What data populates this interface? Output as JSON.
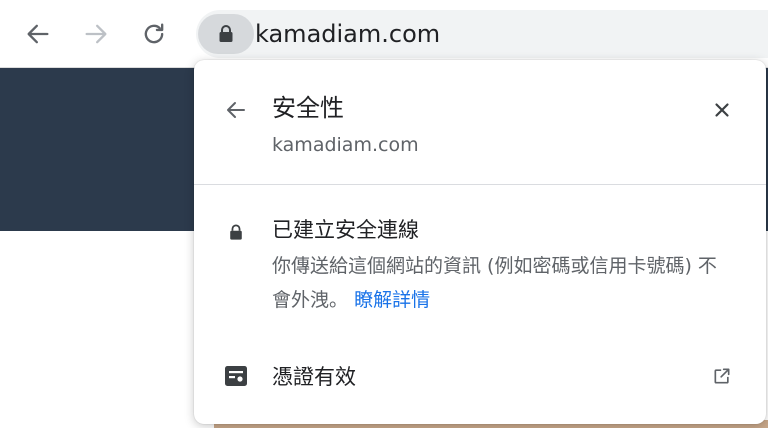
{
  "browser": {
    "url": "kamadiam.com",
    "icons": {
      "back": "arrow-left-icon",
      "forward": "arrow-right-icon",
      "reload": "reload-icon",
      "site_info": "lock-icon"
    }
  },
  "popup": {
    "title": "安全性",
    "subtitle": "kamadiam.com",
    "connection": {
      "title": "已建立安全連線",
      "description": "你傳送給這個網站的資訊 (例如密碼或信用卡號碼) 不會外洩。",
      "link": "瞭解詳情"
    },
    "certificate": {
      "label": "憑證有效"
    }
  },
  "colors": {
    "link": "#1a73e8",
    "page_header": "#2c3a4c",
    "omnibox": "#f1f3f4"
  }
}
